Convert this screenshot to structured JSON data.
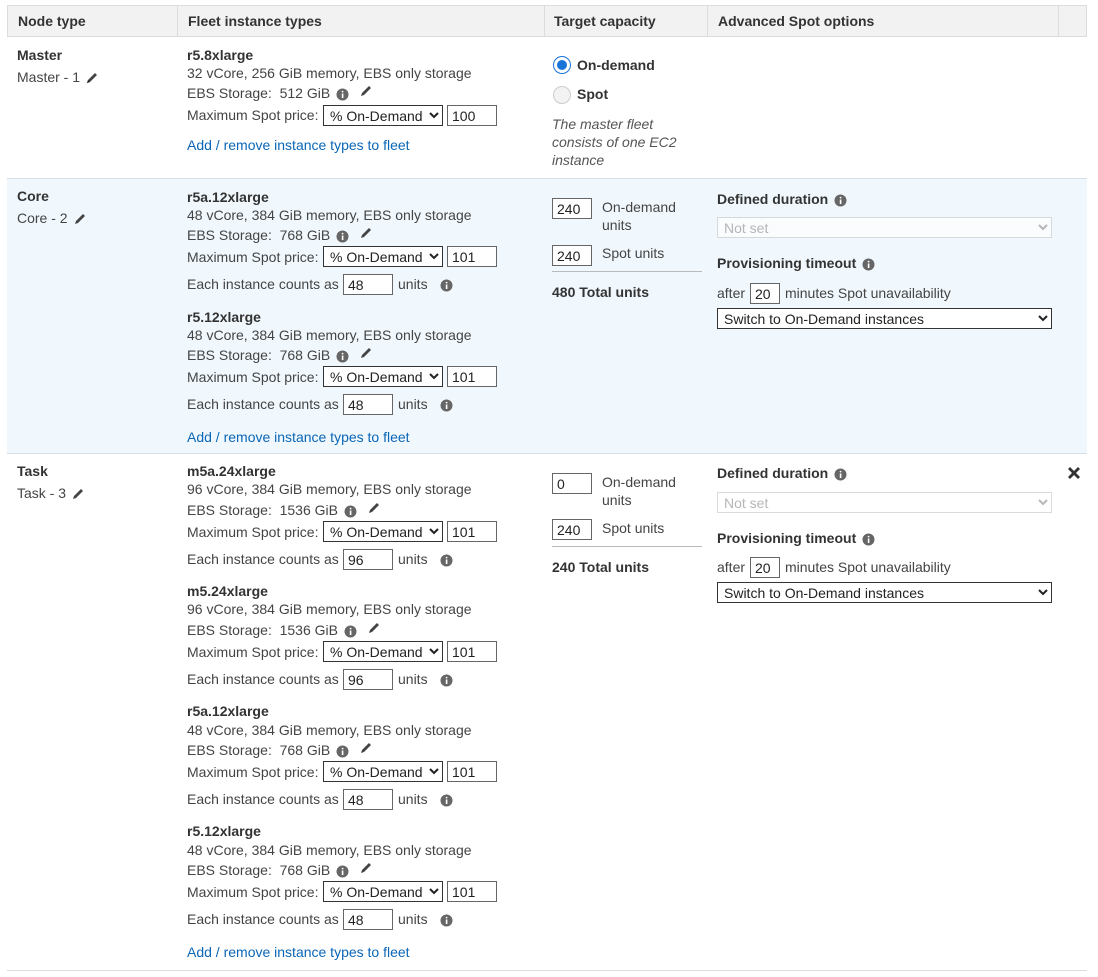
{
  "headers": [
    "Node type",
    "Fleet instance types",
    "Target capacity",
    "Advanced Spot options"
  ],
  "labels": {
    "ebs_storage": "EBS Storage:",
    "max_spot_price": "Maximum Spot price:",
    "each_counts": "Each instance counts as",
    "units": "units",
    "add_remove": "Add / remove instance types to fleet",
    "on_demand_units": "On-demand units",
    "spot_units": "Spot units",
    "defined_duration": "Defined duration",
    "provisioning_timeout": "Provisioning timeout",
    "after": "after",
    "minutes_spot": "minutes Spot unavailability",
    "not_set": "Not set",
    "switch_od": "Switch to On-Demand instances",
    "price_option": "% On-Demand"
  },
  "master": {
    "name": "Master",
    "sub": "Master - 1",
    "radio_on_demand": "On-demand",
    "radio_spot": "Spot",
    "selected": "On-demand",
    "note": "The master fleet consists of one EC2 instance",
    "instances": [
      {
        "name": "r5.8xlarge",
        "spec": "32 vCore, 256 GiB memory, EBS only storage",
        "ebs": "512 GiB",
        "price": "100"
      }
    ]
  },
  "core": {
    "name": "Core",
    "sub": "Core - 2",
    "on_demand_units": "240",
    "spot_units": "240",
    "total": "480 Total units",
    "after_minutes": "20",
    "instances": [
      {
        "name": "r5a.12xlarge",
        "spec": "48 vCore, 384 GiB memory, EBS only storage",
        "ebs": "768 GiB",
        "price": "101",
        "weight": "48"
      },
      {
        "name": "r5.12xlarge",
        "spec": "48 vCore, 384 GiB memory, EBS only storage",
        "ebs": "768 GiB",
        "price": "101",
        "weight": "48"
      }
    ]
  },
  "task": {
    "name": "Task",
    "sub": "Task - 3",
    "on_demand_units": "0",
    "spot_units": "240",
    "total": "240 Total units",
    "after_minutes": "20",
    "instances": [
      {
        "name": "m5a.24xlarge",
        "spec": "96 vCore, 384 GiB memory, EBS only storage",
        "ebs": "1536 GiB",
        "price": "101",
        "weight": "96"
      },
      {
        "name": "m5.24xlarge",
        "spec": "96 vCore, 384 GiB memory, EBS only storage",
        "ebs": "1536 GiB",
        "price": "101",
        "weight": "96"
      },
      {
        "name": "r5a.12xlarge",
        "spec": "48 vCore, 384 GiB memory, EBS only storage",
        "ebs": "768 GiB",
        "price": "101",
        "weight": "48"
      },
      {
        "name": "r5.12xlarge",
        "spec": "48 vCore, 384 GiB memory, EBS only storage",
        "ebs": "768 GiB",
        "price": "101",
        "weight": "48"
      }
    ]
  },
  "colors": {
    "accent": "#1a73d9",
    "link": "#0a66b7",
    "core_bg": "#f1f8fd"
  }
}
